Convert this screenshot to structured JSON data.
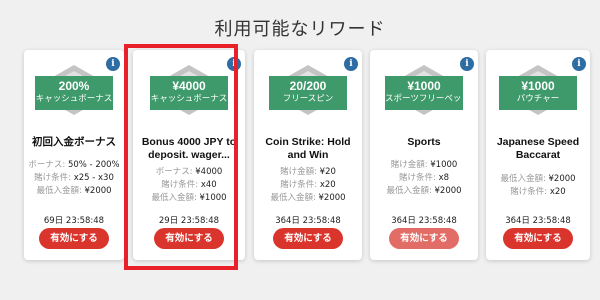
{
  "page": {
    "title": "利用可能なリワード"
  },
  "colors": {
    "badge": "#3f9a6b",
    "button": "#d9352c",
    "info": "#2e6da4",
    "highlight": "#e8202a"
  },
  "cards": [
    {
      "amount": "200%",
      "subtitle": "キャッシュボーナス",
      "title_lines": [
        "初回入金ボーナス",
        ""
      ],
      "details": [
        {
          "label": "ボーナス:",
          "value": "50% - 200%"
        },
        {
          "label": "賭け条件:",
          "value": "x25 - x30"
        },
        {
          "label": "最低入金額:",
          "value": "¥2000"
        }
      ],
      "timer": "69日  23:58:48",
      "button": "有効にする"
    },
    {
      "amount": "¥4000",
      "subtitle": "キャッシュボーナス",
      "title_lines": [
        "Bonus 4000 JPY to",
        "deposit. wager..."
      ],
      "details": [
        {
          "label": "ボーナス:",
          "value": "¥4000"
        },
        {
          "label": "賭け条件:",
          "value": "x40"
        },
        {
          "label": "最低入金額:",
          "value": "¥1000"
        }
      ],
      "timer": "29日  23:58:48",
      "button": "有効にする"
    },
    {
      "amount": "20/200",
      "subtitle": "フリースピン",
      "title_lines": [
        "Coin Strike: Hold",
        "and Win"
      ],
      "details": [
        {
          "label": "賭け金額:",
          "value": "¥20"
        },
        {
          "label": "賭け条件:",
          "value": "x20"
        },
        {
          "label": "最低入金額:",
          "value": "¥2000"
        }
      ],
      "timer": "364日  23:58:48",
      "button": "有効にする"
    },
    {
      "amount": "¥1000",
      "subtitle": "スポーツフリーベット",
      "title_lines": [
        "Sports",
        ""
      ],
      "details": [
        {
          "label": "賭け金額:",
          "value": "¥1000"
        },
        {
          "label": "賭け条件:",
          "value": "x8"
        },
        {
          "label": "最低入金額:",
          "value": "¥2000"
        }
      ],
      "timer": "364日  23:58:48",
      "button": "有効にする"
    },
    {
      "amount": "¥1000",
      "subtitle": "バウチャー",
      "title_lines": [
        "Japanese Speed",
        "Baccarat"
      ],
      "details": [
        {
          "label": "最低入金額:",
          "value": "¥2000"
        },
        {
          "label": "賭け条件:",
          "value": "x20"
        }
      ],
      "timer": "364日  23:58:48",
      "button": "有効にする"
    }
  ]
}
